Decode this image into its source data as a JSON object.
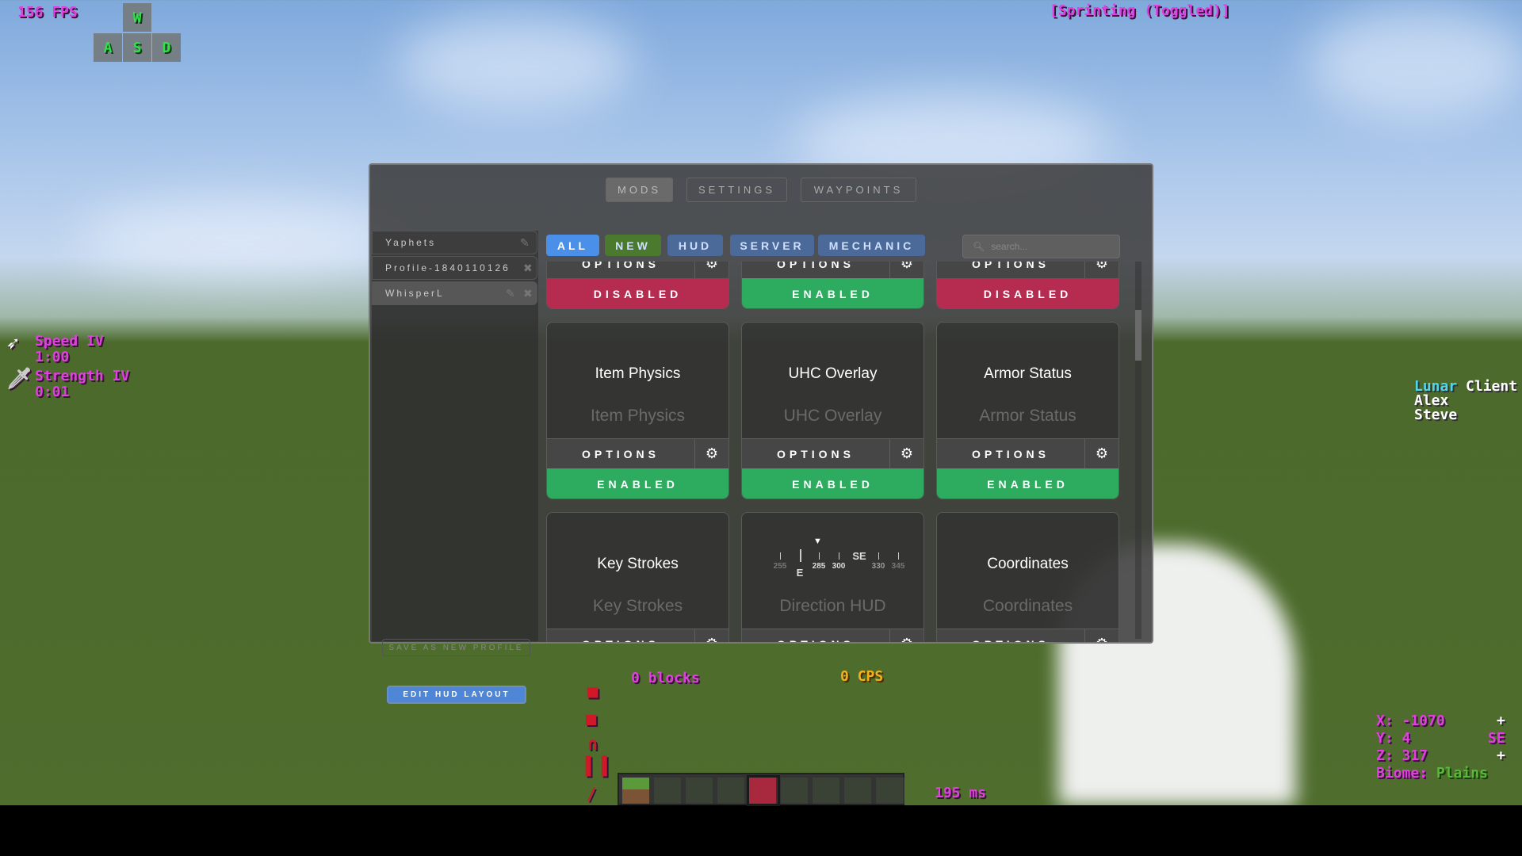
{
  "hud": {
    "fps": "156 FPS",
    "keys": [
      "W",
      "A",
      "S",
      "D"
    ],
    "sprint": "[Sprinting (Toggled)]",
    "effects": [
      {
        "name": "Speed IV",
        "time": "1:00",
        "icon": "speed-icon"
      },
      {
        "name": "Strength IV",
        "time": "0:01",
        "icon": "sword-icon"
      }
    ],
    "scoreboard": {
      "brand1": "Lunar",
      "brand2": "Client",
      "lines": [
        "Alex",
        "Steve"
      ]
    },
    "blocks": "0 blocks",
    "cps": "0 CPS",
    "ping": "195 ms",
    "coords": {
      "x": "X: -1070",
      "y": "Y: 4",
      "z": "Z: 317",
      "biome_label": "Biome:",
      "biome": "Plains",
      "dir1": "+",
      "dir2": "SE",
      "dir3": "+"
    },
    "hotbar": {
      "selected_slot": 4,
      "slots": 9
    }
  },
  "menu": {
    "tabs": [
      {
        "label": "MODS",
        "active": true
      },
      {
        "label": "SETTINGS"
      },
      {
        "label": "WAYPOINTS"
      }
    ],
    "profiles": [
      {
        "name": "Yaphets"
      },
      {
        "name": "Profile-1840110126"
      },
      {
        "name": "WhisperL",
        "active": true
      }
    ],
    "save_profile": "SAVE AS NEW PROFILE",
    "edit_hud": "EDIT HUD LAYOUT",
    "filters": [
      {
        "label": "ALL",
        "color": "#4a8fe8",
        "active": true
      },
      {
        "label": "NEW",
        "color": "#4b7a2e"
      },
      {
        "label": "HUD",
        "color": "#4b6a9a"
      },
      {
        "label": "SERVER",
        "color": "#4b6a9a"
      },
      {
        "label": "MECHANIC",
        "color": "#4b6a9a"
      }
    ],
    "search_placeholder": "search...",
    "options_label": "OPTIONS",
    "colors": {
      "enabled": "#2dab5f",
      "disabled": "#b52c50"
    },
    "mods": [
      {
        "title": "",
        "subtitle": "",
        "status": "DISABLED"
      },
      {
        "title": "",
        "subtitle": "",
        "status": "ENABLED"
      },
      {
        "title": "",
        "subtitle": "",
        "status": "DISABLED"
      },
      {
        "title": "Item Physics",
        "subtitle": "Item Physics",
        "status": "ENABLED"
      },
      {
        "title": "UHC Overlay",
        "subtitle": "UHC Overlay",
        "status": "ENABLED"
      },
      {
        "title": "Armor Status",
        "subtitle": "Armor Status",
        "status": "ENABLED"
      },
      {
        "title": "Key Strokes",
        "subtitle": "Key Strokes",
        "status": ""
      },
      {
        "title": "",
        "subtitle": "Direction HUD",
        "status": "",
        "compass": {
          "ticks": [
            "255",
            "E",
            "285",
            "300",
            "SE",
            "330",
            "345"
          ]
        }
      },
      {
        "title": "Coordinates",
        "subtitle": "Coordinates",
        "status": ""
      }
    ]
  }
}
